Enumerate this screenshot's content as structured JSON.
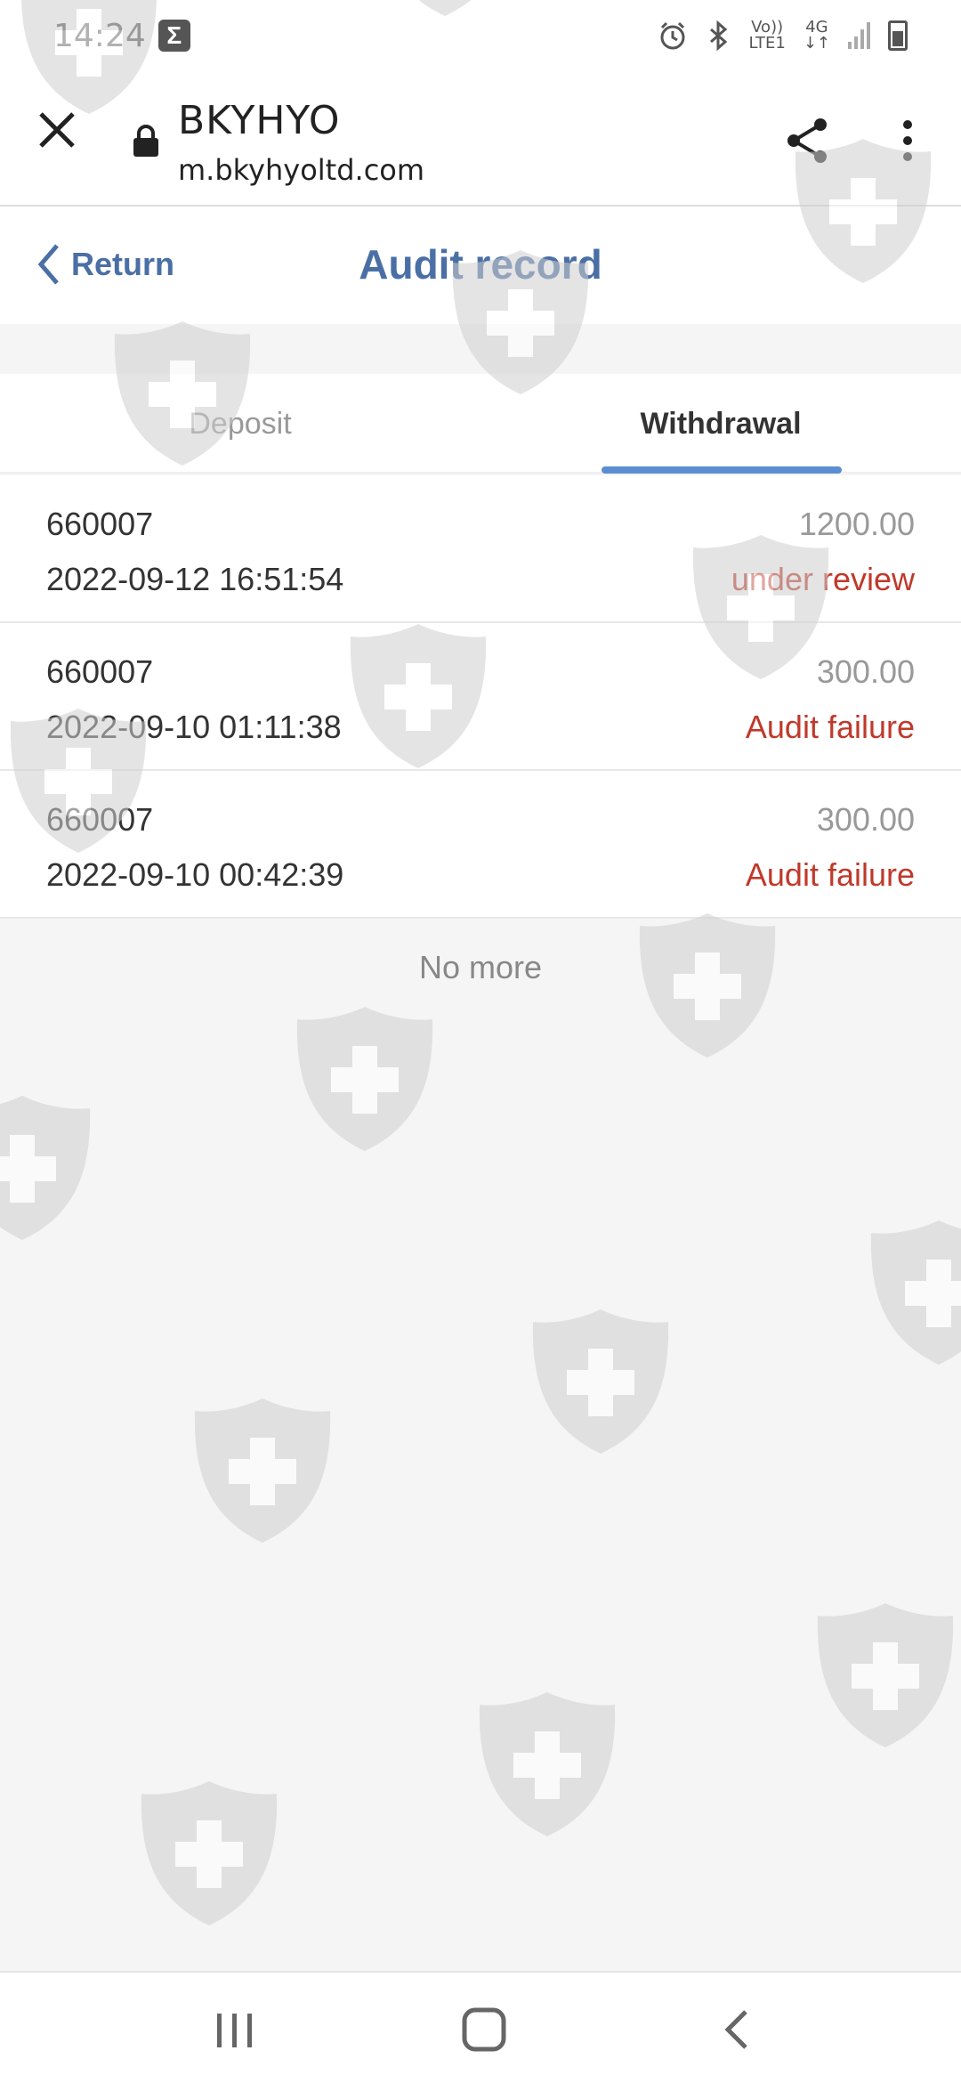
{
  "status_bar": {
    "time": "14:24",
    "app_icon": "sigma",
    "network_top": "Vo))",
    "network_bottom": "LTE1",
    "net_type": "4G",
    "icons": [
      "alarm-icon",
      "bluetooth-icon",
      "signal-icon",
      "battery-icon"
    ]
  },
  "browser": {
    "title": "BKYHYO",
    "url": "m.bkyhyoltd.com"
  },
  "header": {
    "return_label": "Return",
    "title": "Audit record"
  },
  "tabs": [
    {
      "label": "Deposit",
      "active": false
    },
    {
      "label": "Withdrawal",
      "active": true
    }
  ],
  "records": [
    {
      "id": "660007",
      "time": "2022-09-12 16:51:54",
      "amount": "1200.00",
      "status": "under review"
    },
    {
      "id": "660007",
      "time": "2022-09-10 01:11:38",
      "amount": "300.00",
      "status": "Audit failure"
    },
    {
      "id": "660007",
      "time": "2022-09-10 00:42:39",
      "amount": "300.00",
      "status": "Audit failure"
    }
  ],
  "footer": {
    "no_more": "No more"
  },
  "colors": {
    "accent": "#4a6fa5",
    "tab_indicator": "#5b8ed1",
    "status_red": "#c0392b",
    "muted": "#999999"
  }
}
